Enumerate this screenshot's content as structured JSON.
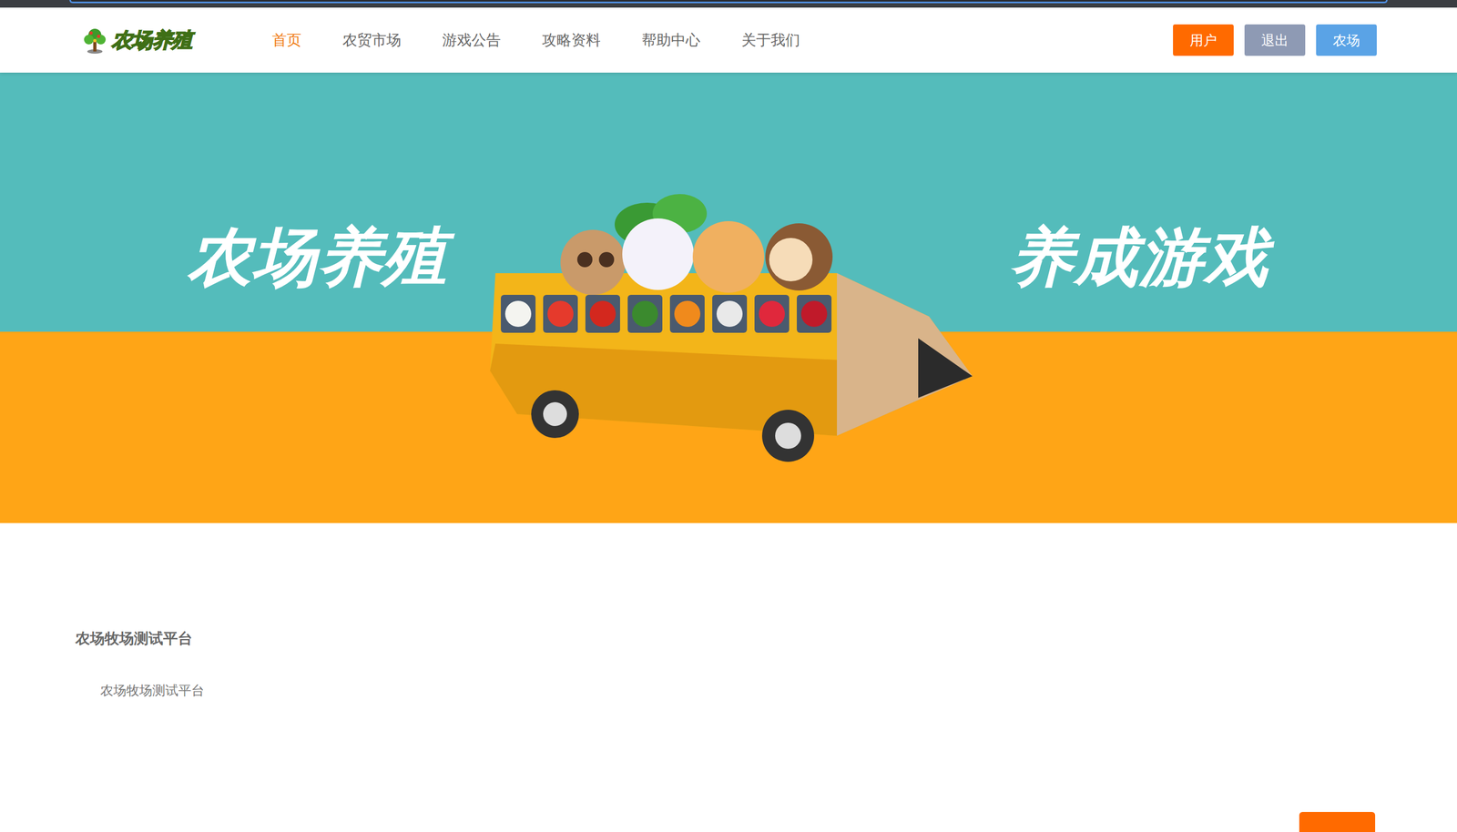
{
  "logo": {
    "text": "农场养殖"
  },
  "nav": [
    {
      "label": "首页",
      "selected": true
    },
    {
      "label": "农贸市场",
      "selected": false
    },
    {
      "label": "游戏公告",
      "selected": false
    },
    {
      "label": "攻略资料",
      "selected": false
    },
    {
      "label": "帮助中心",
      "selected": false
    },
    {
      "label": "关于我们",
      "selected": false
    }
  ],
  "header_buttons": [
    {
      "label": "用户",
      "color": "#ff6a00"
    },
    {
      "label": "退出",
      "color": "#8e9ab4"
    },
    {
      "label": "农场",
      "color": "#5aa3e6"
    }
  ],
  "banner": {
    "left_text": "农场养殖",
    "right_text": "养成游戏"
  },
  "content": {
    "title": "农场牧场测试平台",
    "text": "农场牧场测试平台"
  }
}
